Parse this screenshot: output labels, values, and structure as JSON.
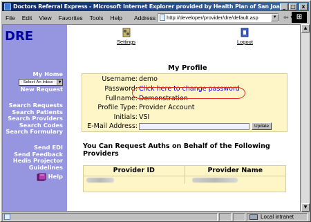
{
  "window": {
    "title": "Doctors Referral Express - Microsoft Internet Explorer provided by Health Plan of San Joaquin",
    "min": "_",
    "max": "□",
    "close": "x"
  },
  "menu": {
    "items": [
      "File",
      "Edit",
      "View",
      "Favorites",
      "Tools",
      "Help"
    ],
    "address_label": "Address",
    "url": "http://developer/provider/dre/default.asp",
    "back": "⇦ ▾",
    "links": "» "
  },
  "toolbar": {
    "settings_label": "Settings",
    "logout_label": "Logout"
  },
  "sidebar": {
    "logo": "DRE",
    "my_home": "My Home",
    "inbox_select": "- Select An Inbox -",
    "new_request": "New Request",
    "search_requests": "Search Requests",
    "search_patients": "Search Patients",
    "search_providers": "Search Providers",
    "search_codes": "Search Codes",
    "search_formulary": "Search Formulary",
    "send_edi": "Send EDI",
    "send_feedback": "Send Feedback",
    "hedis_projector": "Hedis Projector",
    "guidelines": "Guidelines",
    "help": "Help"
  },
  "profile": {
    "title": "My Profile",
    "username_label": "Username:",
    "username_value": "demo",
    "password_label": "Password:",
    "password_link": "Click here to change password",
    "fullname_label": "Fullname:",
    "fullname_value": "Demonstration",
    "profile_type_label": "Profile Type:",
    "profile_type_value": "Provider Account",
    "initials_label": "Initials:",
    "initials_value": "VSI",
    "email_label": "E-Mail Address:",
    "email_value": "",
    "update_button": "Update"
  },
  "providers": {
    "title": "You Can Request Auths on Behalf of the Following Providers",
    "col_id": "Provider ID",
    "col_name": "Provider Name"
  },
  "status": {
    "text": "",
    "zone": "Local intranet"
  },
  "colors": {
    "sidebar": "#9595e0",
    "logo": "#0000a0",
    "profile_bg": "#fff6c8",
    "link": "#0000cc",
    "highlight_oval": "#e0301e"
  }
}
